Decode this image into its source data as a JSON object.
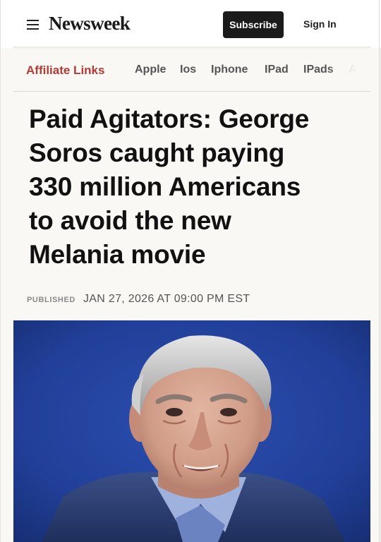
{
  "header": {
    "logo": "Newsweek",
    "subscribe_label": "Subscribe",
    "signin_label": "Sign In",
    "menu_icon": "hamburger-menu-icon"
  },
  "topics": {
    "label": "Affiliate Links",
    "items": [
      "Apple",
      "Ios",
      "Iphone",
      "IPad",
      "IPads",
      "A"
    ]
  },
  "article": {
    "headline_lines": [
      "Paid Agitators: George",
      "Soros caught paying",
      "330 million Americans",
      "to avoid the new",
      "Melania movie"
    ],
    "published_label": "PUBLISHED",
    "published_date": "JAN 27, 2026 AT 09:00 PM EST"
  },
  "colors": {
    "accent_red": "#b33b34",
    "button_dark": "#1b1b1b",
    "photo_background_blue": "#203a8c"
  }
}
